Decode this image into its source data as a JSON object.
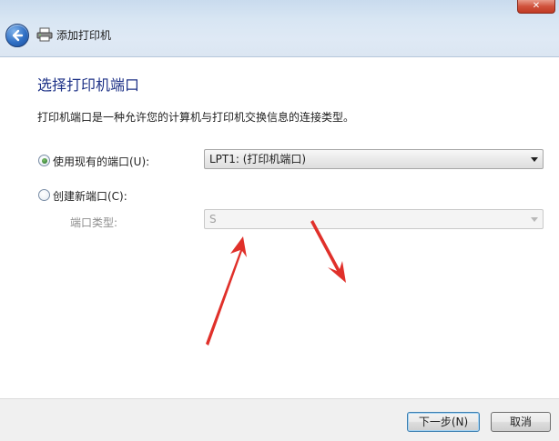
{
  "window": {
    "title": "添加打印机",
    "close_label": "✕",
    "close_color": "#c03a24"
  },
  "icons": {
    "back": "back-arrow-icon",
    "printer": "printer-icon"
  },
  "page": {
    "heading": "选择打印机端口",
    "description": "打印机端口是一种允许您的计算机与打印机交换信息的连接类型。",
    "heading_color": "#1e3287"
  },
  "options": {
    "existing_port": {
      "label": "使用现有的端口(U):",
      "selected": true,
      "value": "LPT1: (打印机端口)"
    },
    "new_port": {
      "label": "创建新端口(C):",
      "selected": false,
      "type_label": "端口类型:",
      "type_value": "S"
    }
  },
  "annotations": {
    "arrow_color": "#e0302a"
  },
  "buttons": {
    "next": "下一步(N)",
    "cancel": "取消"
  }
}
